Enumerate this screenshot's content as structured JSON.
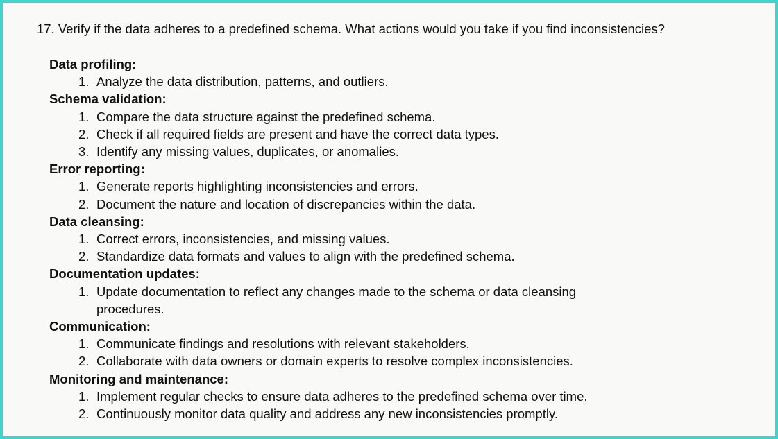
{
  "question": "17. Verify if the data adheres to a predefined schema. What actions would you take if you find inconsistencies?",
  "sections": [
    {
      "heading": "Data profiling:",
      "items": [
        {
          "num": "1.",
          "text": "Analyze the data distribution, patterns, and outliers."
        }
      ]
    },
    {
      "heading": "Schema validation:",
      "items": [
        {
          "num": "1.",
          "text": "Compare the data structure against the predefined schema."
        },
        {
          "num": "2.",
          "text": "Check if all required fields are present and have the correct data types."
        },
        {
          "num": "3.",
          "text": "Identify any missing values, duplicates, or anomalies."
        }
      ]
    },
    {
      "heading": "Error reporting:",
      "items": [
        {
          "num": "1.",
          "text": "Generate reports highlighting inconsistencies and errors."
        },
        {
          "num": "2.",
          "text": "Document the nature and location of discrepancies within the data."
        }
      ]
    },
    {
      "heading": "Data cleansing:",
      "items": [
        {
          "num": "1.",
          "text": "Correct errors, inconsistencies, and missing values."
        },
        {
          "num": "2.",
          "text": "Standardize data formats and values to align with the predefined schema."
        }
      ]
    },
    {
      "heading": "Documentation updates:",
      "items": [
        {
          "num": "1.",
          "text": "Update documentation to reflect any changes made to the schema or data cleansing procedures."
        }
      ]
    },
    {
      "heading": "Communication:",
      "items": [
        {
          "num": "1.",
          "text": "Communicate findings and resolutions with relevant stakeholders."
        },
        {
          "num": "2.",
          "text": "Collaborate with data owners or domain experts to resolve complex inconsistencies."
        }
      ]
    },
    {
      "heading": "Monitoring and maintenance:",
      "items": [
        {
          "num": "1.",
          "text": "Implement regular checks to ensure data adheres to the predefined schema over time."
        },
        {
          "num": "2.",
          "text": "Continuously monitor data quality and address any new inconsistencies promptly."
        }
      ]
    }
  ]
}
